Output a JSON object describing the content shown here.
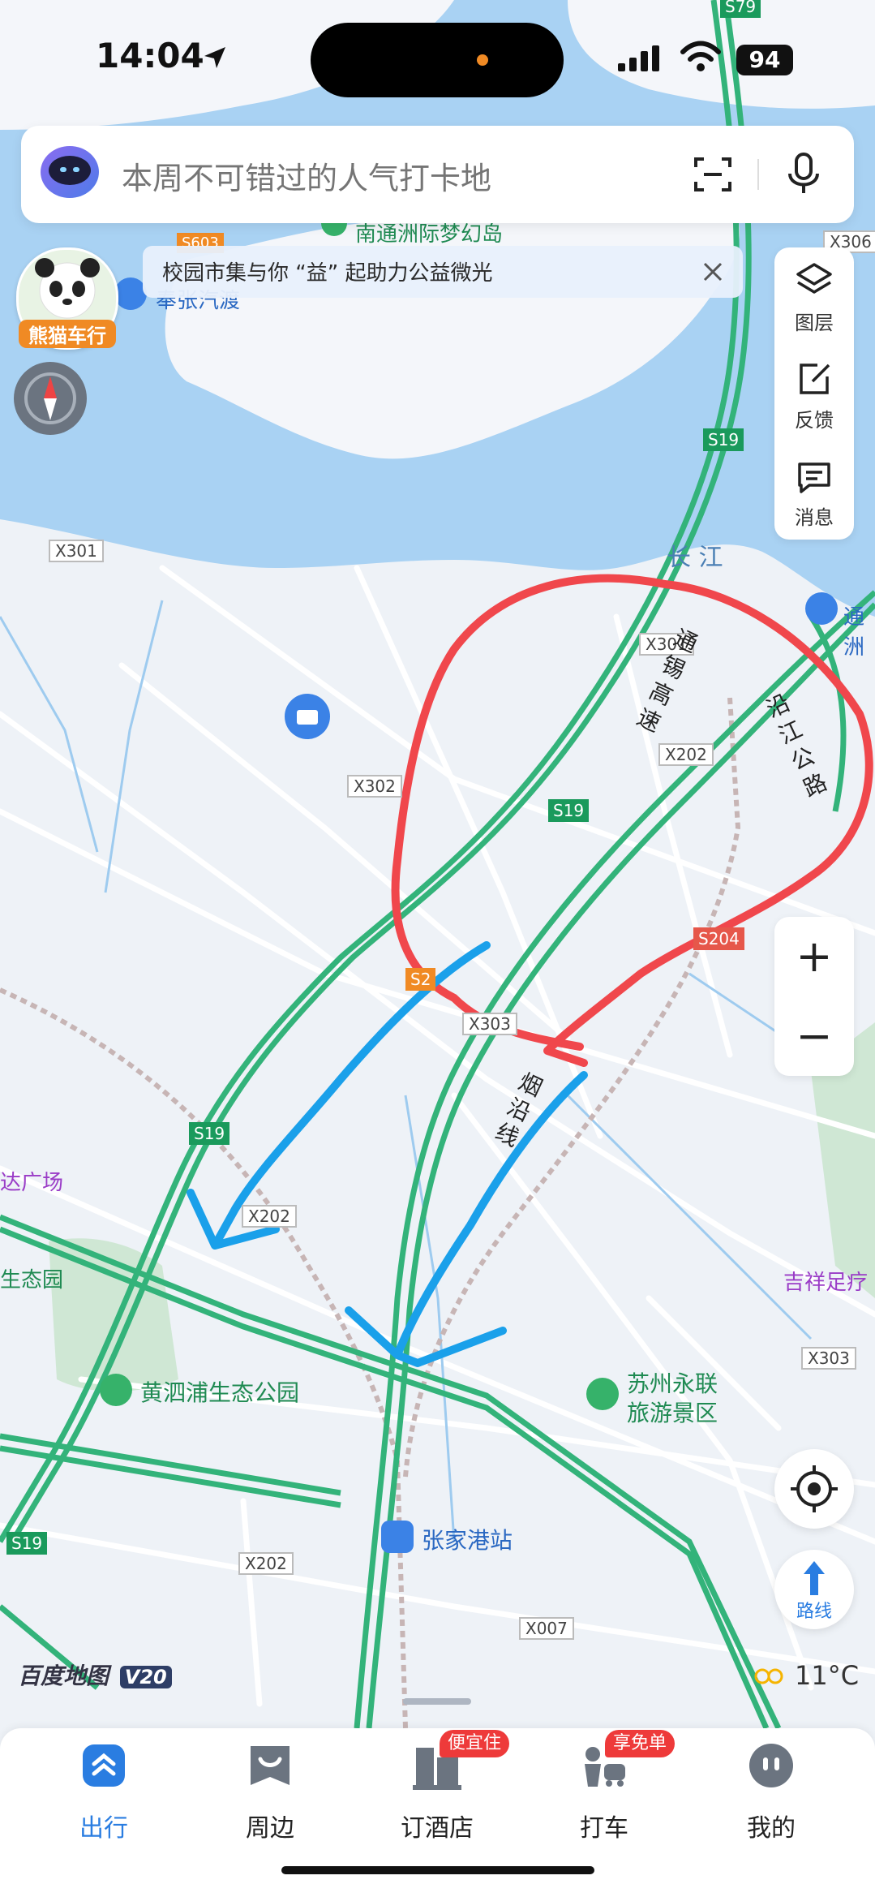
{
  "status_bar": {
    "time": "14:04",
    "battery": "94"
  },
  "search": {
    "placeholder": "本周不可错过的人气打卡地"
  },
  "banner": {
    "text": "校园市集与你 “益” 起助力公益微光"
  },
  "toolbar": {
    "layers_label": "图层",
    "feedback_label": "反馈",
    "messages_label": "消息"
  },
  "zoom": {
    "in": "+",
    "out": "−"
  },
  "route_button": {
    "label": "路线"
  },
  "weather": {
    "temp": "11°C"
  },
  "brand": {
    "name": "百度地图",
    "version": "V20"
  },
  "avatar": {
    "label": "熊猫车行"
  },
  "map": {
    "places": {
      "huangsipu": "黄泗浦生态公园",
      "suzhou": "苏州永联\n旅游景区",
      "zhangjiagang": "张家港站",
      "nantong_dream": "南通洲际梦幻岛",
      "jixiang": "吉祥足疗",
      "wanda": "达广场",
      "shengtaiyuan": "生态园",
      "ferry": "奉张汽渡",
      "tongzhou": "通洲"
    },
    "river": "长 江",
    "roads": {
      "tongxi": "通 锡 高 速",
      "yanjiang": "沿 江 公 路",
      "yanyan": "烟 沿 线"
    },
    "road_codes": {
      "x301a": "X301",
      "x301b": "X301",
      "x302": "X302",
      "x202a": "X202",
      "x202b": "X202",
      "x202c": "X202",
      "x303": "X303",
      "x303b": "X303",
      "x306": "X306",
      "x007": "X007",
      "s19a": "S19",
      "s19b": "S19",
      "s19c": "S19",
      "s19d": "S19",
      "s79": "S79",
      "s603": "S603",
      "s204": "S204",
      "s2": "S2"
    }
  },
  "nav": {
    "items": [
      {
        "label": "出行",
        "active": true
      },
      {
        "label": "周边"
      },
      {
        "label": "订酒店",
        "badge": "便宜住"
      },
      {
        "label": "打车",
        "badge": "享免单"
      },
      {
        "label": "我的"
      }
    ]
  },
  "colors": {
    "accent": "#2a7de1",
    "highway": "#33b37a",
    "water": "#a9d2f3",
    "annotation_red": "#f0474c",
    "annotation_blue": "#1aa0ea"
  }
}
